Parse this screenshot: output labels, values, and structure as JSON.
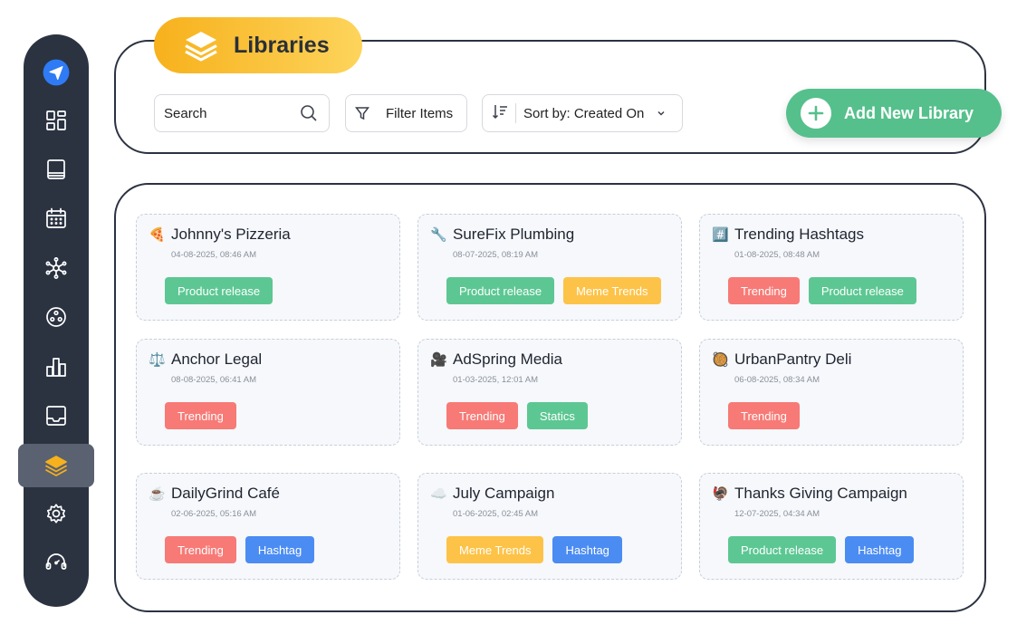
{
  "header": {
    "title": "Libraries"
  },
  "toolbar": {
    "search_placeholder": "Search",
    "filter_label": "Filter Items",
    "sort_label": "Sort by: Created On",
    "add_label": "Add New Library"
  },
  "sidebar": {
    "items": [
      {
        "icon": "send-icon"
      },
      {
        "icon": "dashboard-icon"
      },
      {
        "icon": "library-book-icon"
      },
      {
        "icon": "calendar-icon"
      },
      {
        "icon": "network-icon"
      },
      {
        "icon": "circles-icon"
      },
      {
        "icon": "bar-chart-icon"
      },
      {
        "icon": "inbox-icon"
      },
      {
        "icon": "layers-icon",
        "active": true
      },
      {
        "icon": "settings-icon"
      },
      {
        "icon": "support-icon"
      }
    ]
  },
  "colors": {
    "sidebar": "#2b3341",
    "accent_yellow": "#f7b11c",
    "add_green": "#55c08c",
    "tag_green": "#5cc793",
    "tag_yellow": "#fdc348",
    "tag_red": "#f77a76",
    "tag_blue": "#4b8cf3"
  },
  "libraries": [
    {
      "emoji": "🍕",
      "name": "Johnny's Pizzeria",
      "date": "04-08-2025, 08:46 AM",
      "tags": [
        {
          "label": "Product release",
          "color": "green"
        }
      ]
    },
    {
      "emoji": "🔧",
      "name": "SureFix Plumbing",
      "date": "08-07-2025, 08:19 AM",
      "tags": [
        {
          "label": "Product release",
          "color": "green"
        },
        {
          "label": "Meme Trends",
          "color": "yellow"
        }
      ]
    },
    {
      "emoji": "#️⃣",
      "name": "Trending Hashtags",
      "date": "01-08-2025, 08:48 AM",
      "tags": [
        {
          "label": "Trending",
          "color": "red"
        },
        {
          "label": "Product release",
          "color": "green"
        }
      ]
    },
    {
      "emoji": "⚖️",
      "name": "Anchor Legal",
      "date": "08-08-2025, 06:41 AM",
      "tags": [
        {
          "label": "Trending",
          "color": "red"
        }
      ]
    },
    {
      "emoji": "🎥",
      "name": "AdSpring Media",
      "date": "01-03-2025, 12:01 AM",
      "tags": [
        {
          "label": "Trending",
          "color": "red"
        },
        {
          "label": "Statics",
          "color": "green"
        }
      ]
    },
    {
      "emoji": "🥘",
      "name": "UrbanPantry Deli",
      "date": "06-08-2025, 08:34 AM",
      "tags": [
        {
          "label": "Trending",
          "color": "red"
        }
      ]
    },
    {
      "emoji": "☕",
      "name": "DailyGrind Café",
      "date": "02-06-2025, 05:16 AM",
      "tags": [
        {
          "label": "Trending",
          "color": "red"
        },
        {
          "label": "Hashtag",
          "color": "blue"
        }
      ]
    },
    {
      "emoji": "☁️",
      "name": "July Campaign",
      "date": "01-06-2025, 02:45 AM",
      "tags": [
        {
          "label": "Meme Trends",
          "color": "yellow"
        },
        {
          "label": "Hashtag",
          "color": "blue"
        }
      ]
    },
    {
      "emoji": "🦃",
      "name": "Thanks Giving Campaign",
      "date": "12-07-2025, 04:34 AM",
      "tags": [
        {
          "label": "Product release",
          "color": "green"
        },
        {
          "label": "Hashtag",
          "color": "blue"
        }
      ]
    }
  ]
}
